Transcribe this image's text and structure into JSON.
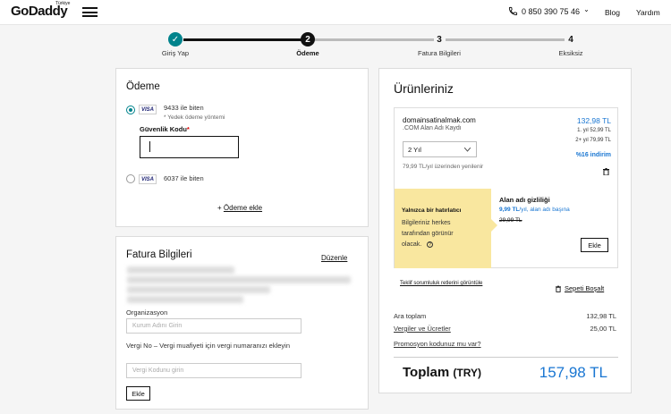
{
  "header": {
    "logo": "GoDaddy",
    "logo_region": "Türkiye",
    "phone": "0 850 390 75 46",
    "phone_caret": "⌄",
    "blog": "Blog",
    "help": "Yardım"
  },
  "steps": [
    {
      "label": "Giriş Yap",
      "num": "✓"
    },
    {
      "label": "Ödeme",
      "num": "2"
    },
    {
      "label": "Fatura Bilgileri",
      "num": "3"
    },
    {
      "label": "Eksiksiz",
      "num": "4"
    }
  ],
  "payment": {
    "title": "Ödeme",
    "card1": {
      "brand": "VISA",
      "text": "9433 ile biten",
      "note": "* Yedek ödeme yöntemi"
    },
    "security_label": "Güvenlik Kodu",
    "required": "*",
    "security_value": "",
    "card2": {
      "brand": "VISA",
      "text": "6037 ile biten"
    },
    "add_payment": "Ödeme ekle",
    "plus": "+"
  },
  "billing": {
    "title": "Fatura Bilgileri",
    "edit": "Düzenle",
    "org_label": "Organizasyon",
    "org_placeholder": "Kurum Adını Girin",
    "tax_label": "Vergi No – Vergi muafiyeti için vergi numaranızı ekleyin",
    "tax_placeholder": "Vergi Kodunu girin",
    "add": "Ekle"
  },
  "products": {
    "title": "Ürünleriniz",
    "domain": "domainsatinalmak.com",
    "domain_type": ".COM Alan Adı Kaydı",
    "price": "132,98 TL",
    "price_y1": "1. yıl 52,99 TL",
    "price_y2": "2+ yıl 79,99 TL",
    "discount": "%16 indirim",
    "term": "2 Yıl",
    "renew": "79,99 TL/yıl üzerinden yenilenir",
    "reminder_title": "Yalnızca bir hatırlatıcı",
    "reminder_body": "Bilgileriniz herkes tarafından görünür olacak.",
    "privacy_title": "Alan adı gizliliği",
    "privacy_price": "9,99 TL",
    "privacy_unit": "/yıl, alan adı başına",
    "privacy_old": "29,99 TL",
    "privacy_add": "Ekle",
    "offer_link": "Teklif sorumluluk retlerini görüntüle",
    "empty_cart": "Sepeti Boşalt",
    "subtotal_label": "Ara toplam",
    "subtotal": "132,98 TL",
    "tax_label": "Vergiler ve Ücretler",
    "tax": "25,00 TL",
    "promo": "Promosyon kodunuz mu var?",
    "total_label": "Toplam",
    "total_currency": "(TRY)",
    "total": "157,98 TL"
  },
  "colors": {
    "accent": "#00838c",
    "blue": "#1976d2",
    "yellow": "#f9e79f"
  }
}
